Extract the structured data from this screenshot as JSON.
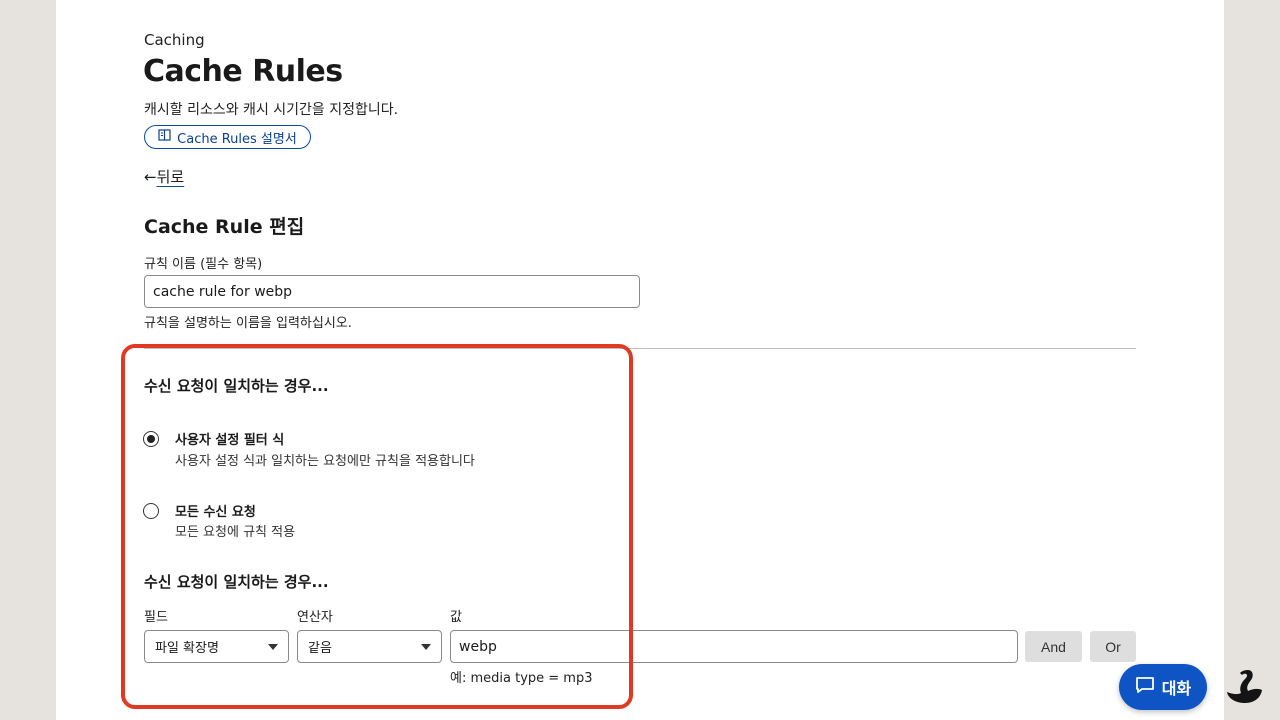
{
  "breadcrumb": "Caching",
  "page": {
    "title": "Cache Rules",
    "description": "캐시할 리소스와 캐시 시기간을 지정합니다.",
    "docs_button": "Cache Rules 설명서",
    "back_label": "뒤로",
    "back_arrow": "←"
  },
  "form": {
    "heading": "Cache Rule 편집",
    "name_label": "규칙 이름 (필수 항목)",
    "name_value": "cache rule for webp",
    "name_helper": "규칙을 설명하는 이름을 입력하십시오."
  },
  "match_section": {
    "heading": "수신 요청이 일치하는 경우...",
    "options": [
      {
        "title": "사용자 설정 필터 식",
        "description": "사용자 설정 식과 일치하는 요청에만 규칙을 적용합니다",
        "selected": true
      },
      {
        "title": "모든 수신 요청",
        "description": "모든 요청에 규칙 적용",
        "selected": false
      }
    ]
  },
  "expression": {
    "heading": "수신 요청이 일치하는 경우...",
    "field_label": "필드",
    "operator_label": "연산자",
    "value_label": "값",
    "field_value": "파일 확장명",
    "operator_value": "같음",
    "value": "webp",
    "example": "예: media type = mp3",
    "and_label": "And",
    "or_label": "Or"
  },
  "chat_button": "대화",
  "colors": {
    "accent": "#0f54c5",
    "highlight": "#e03a24",
    "background": "#e6e3de"
  }
}
